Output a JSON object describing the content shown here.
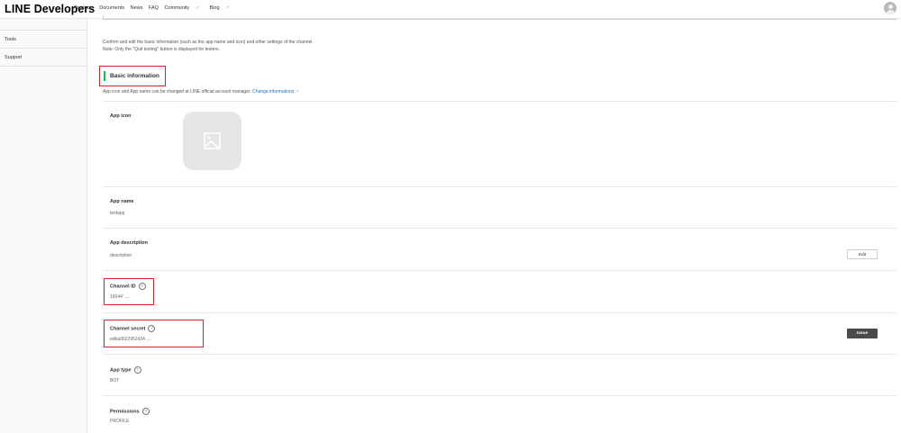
{
  "header": {
    "logo_brand": "LINE",
    "logo_text": "Developers",
    "nav": [
      {
        "label": "Products",
        "external": false
      },
      {
        "label": "Documents",
        "external": false
      },
      {
        "label": "News",
        "external": false
      },
      {
        "label": "FAQ",
        "external": false
      },
      {
        "label": "Community",
        "external": true
      },
      {
        "label": "Blog",
        "external": true
      }
    ],
    "external_icon": "external-link-icon",
    "avatar_icon": "user-avatar-icon"
  },
  "sidebar": {
    "items": [
      {
        "label": "Tools"
      },
      {
        "label": "Support"
      }
    ]
  },
  "main": {
    "intro_line1": "Confirm and edit the basic information (such as the app name and icon) and other settings of the channel.",
    "intro_line2": "Note: Only the \"Quit testing\" button is displayed for testers.",
    "section_title": "Basic information",
    "note_text": "App icon and App name can be changed at LINE official account manager.",
    "note_link": "Change informations",
    "fields": {
      "app_icon": {
        "label": "App icon",
        "icon": "image-placeholder-icon"
      },
      "app_name": {
        "label": "App name",
        "value": "testapp"
      },
      "app_description": {
        "label": "App description",
        "value": "description",
        "button": "Edit"
      },
      "channel_id": {
        "label": "Channel ID",
        "value": "16044’ ...."
      },
      "channel_secret": {
        "label": "Channel secret",
        "value": "edba0622952d34 ....",
        "button": "Issue"
      },
      "app_type": {
        "label": "App type",
        "value": "BOT"
      },
      "permissions": {
        "label": "Permissions",
        "value": "PROFILE"
      }
    },
    "help_glyph": "?"
  },
  "colors": {
    "accent_green": "#06c755",
    "link_blue": "#1a6fc7",
    "highlight_red": "#e02020",
    "issue_button": "#4a4a4a"
  }
}
